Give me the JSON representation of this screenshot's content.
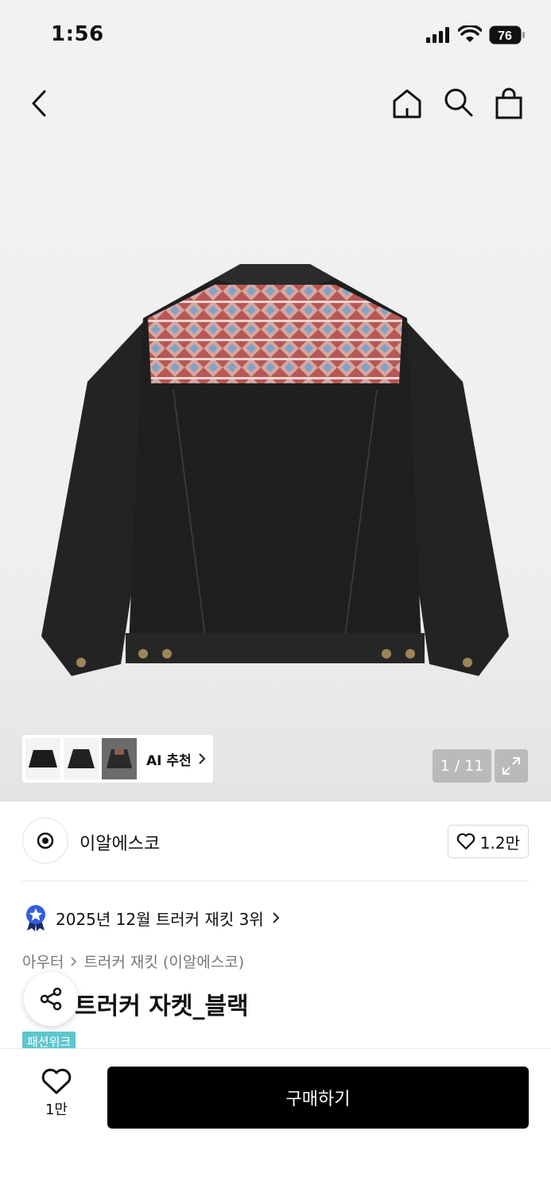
{
  "status_bar": {
    "time": "1:56",
    "battery": "76"
  },
  "header": {
    "icons": [
      "back-icon",
      "home-icon",
      "search-icon",
      "shopping-bag-icon"
    ]
  },
  "gallery": {
    "ai_recommend_label": "AI 추천",
    "page_indicator": "1 / 11"
  },
  "brand": {
    "name": "이알에스코",
    "likes": "1.2만"
  },
  "ranking": {
    "text": "2025년 12월 트러커 재킷 3위"
  },
  "breadcrumb": [
    "아우터",
    "트러커 재킷 (이알에스코)"
  ],
  "product": {
    "title": "트러커 자켓_블랙",
    "badge": "패션위크"
  },
  "bottom_bar": {
    "wish_count": "1만",
    "buy_label": "구매하기"
  },
  "colors": {
    "primary_button": "#000000",
    "badge": "#5fc6cf",
    "rank_icon_blue": "#2f5fe0"
  }
}
